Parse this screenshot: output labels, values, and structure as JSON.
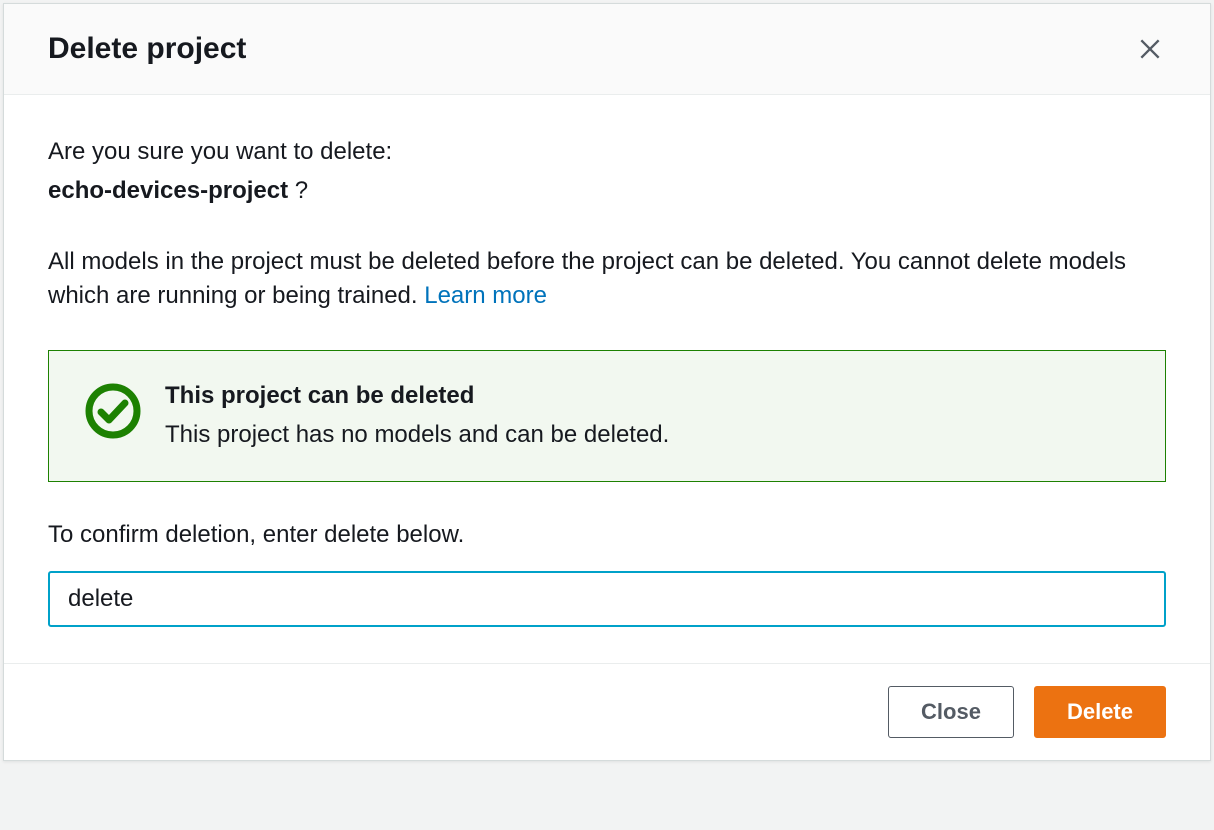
{
  "modal": {
    "title": "Delete project",
    "confirm_question": "Are you sure you want to delete:",
    "project_name": "echo-devices-project",
    "question_suffix": " ?",
    "info_text": "All models in the project must be deleted before the project can be deleted. You cannot delete models which are running or being trained. ",
    "learn_more": "Learn more",
    "alert": {
      "title": "This project can be deleted",
      "desc": "This project has no models and can be deleted."
    },
    "confirm_label": "To confirm deletion, enter delete below.",
    "input_value": "delete",
    "buttons": {
      "close": "Close",
      "delete": "Delete"
    }
  }
}
